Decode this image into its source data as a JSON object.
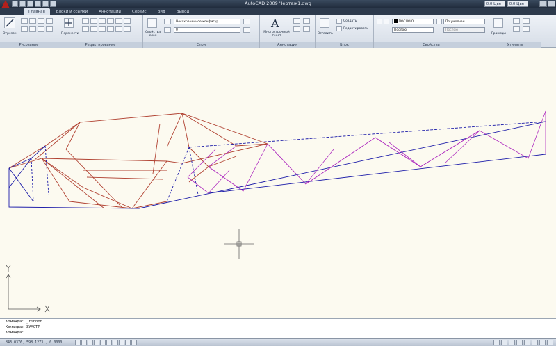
{
  "window": {
    "title": "AutoCAD 2009 Чертеж1.dwg",
    "search_box_1": "0,0 Цвет",
    "search_box_2": "0,0 Цвет"
  },
  "tabs": [
    "Главная",
    "Блоки и ссылки",
    "Аннотации",
    "Сервис",
    "Вид",
    "Вывод"
  ],
  "active_tab": "Главная",
  "ribbon": {
    "panels": {
      "draw": "Рисование",
      "modify": "Редактирование",
      "layers": "Слои",
      "annotation": "Аннотация",
      "block": "Блок",
      "properties": "Свойства",
      "utilities": "Утилиты"
    },
    "tools": {
      "cut_label": "Отрезок",
      "move_label": "Перенести",
      "layer_props_label": "Свойства слоя",
      "layer_state": "Несохраненное конфигур",
      "layer_current": "0",
      "mtext_label": "Многострочный текст",
      "insert_label": "Вставить",
      "create_label": "Создать",
      "edit_label": "Редактировать",
      "color_value": "ПОСЛОЮ",
      "linetype_value": "Послою",
      "lineweight_value": "По умолчан",
      "plotstyle_value": "Послою",
      "measure_label": "Границы"
    }
  },
  "command_line": {
    "line1": "Команда:  _ribbon",
    "line2": "Команда:  ЗУМСТР",
    "line3": "Команда:"
  },
  "status": {
    "coords": "843.0376, 598.1273 , 0.0000"
  },
  "colors": {
    "frame_red": "#b04030",
    "frame_blue": "#1a1aa8",
    "frame_magenta": "#b030c0",
    "canvas_bg": "#fcfaf0"
  }
}
